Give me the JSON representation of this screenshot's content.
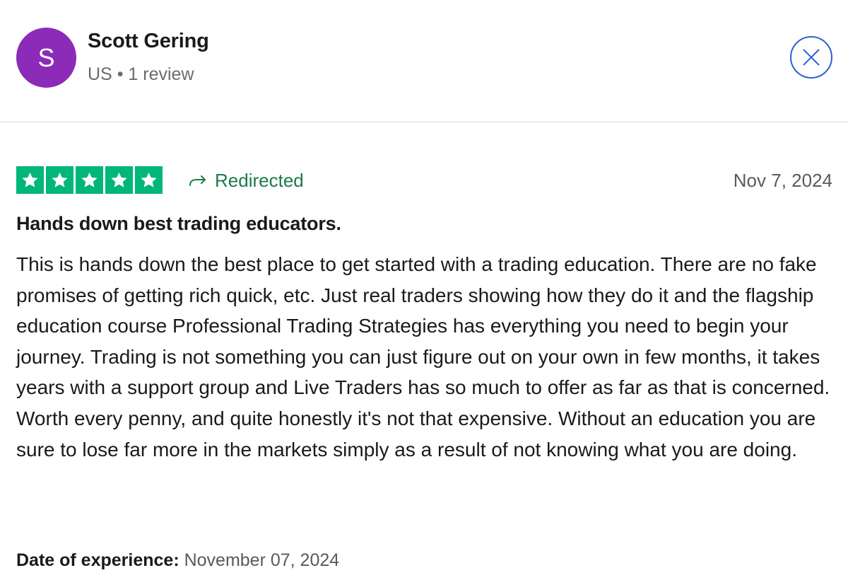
{
  "reviewer": {
    "initial": "S",
    "name": "Scott Gering",
    "country": "US",
    "separator": "•",
    "review_count": "1 review",
    "avatar_color": "#8c2bb8"
  },
  "review": {
    "rating": 5,
    "rating_max": 5,
    "star_color": "#00b67a",
    "status": "Redirected",
    "date": "Nov 7, 2024",
    "title": "Hands down best trading educators.",
    "body": "This is hands down the best place to get started with a trading education. There are no fake promises of getting rich quick, etc. Just real traders showing how they do it and the flagship education course Professional Trading Strategies has everything you need to begin your journey. Trading is not something you can just figure out on your own in few months, it takes years with a support group and Live Traders has so much to offer as far as that is concerned. Worth every penny, and quite honestly it's not that expensive. Without an education you are sure to lose far more in the markets simply as a result of not knowing what you are doing.",
    "experience_label": "Date of experience:",
    "experience_date": "November 07, 2024"
  },
  "icons": {
    "close": "close-icon",
    "star": "star-icon",
    "redirect": "redirect-arrow-icon"
  }
}
